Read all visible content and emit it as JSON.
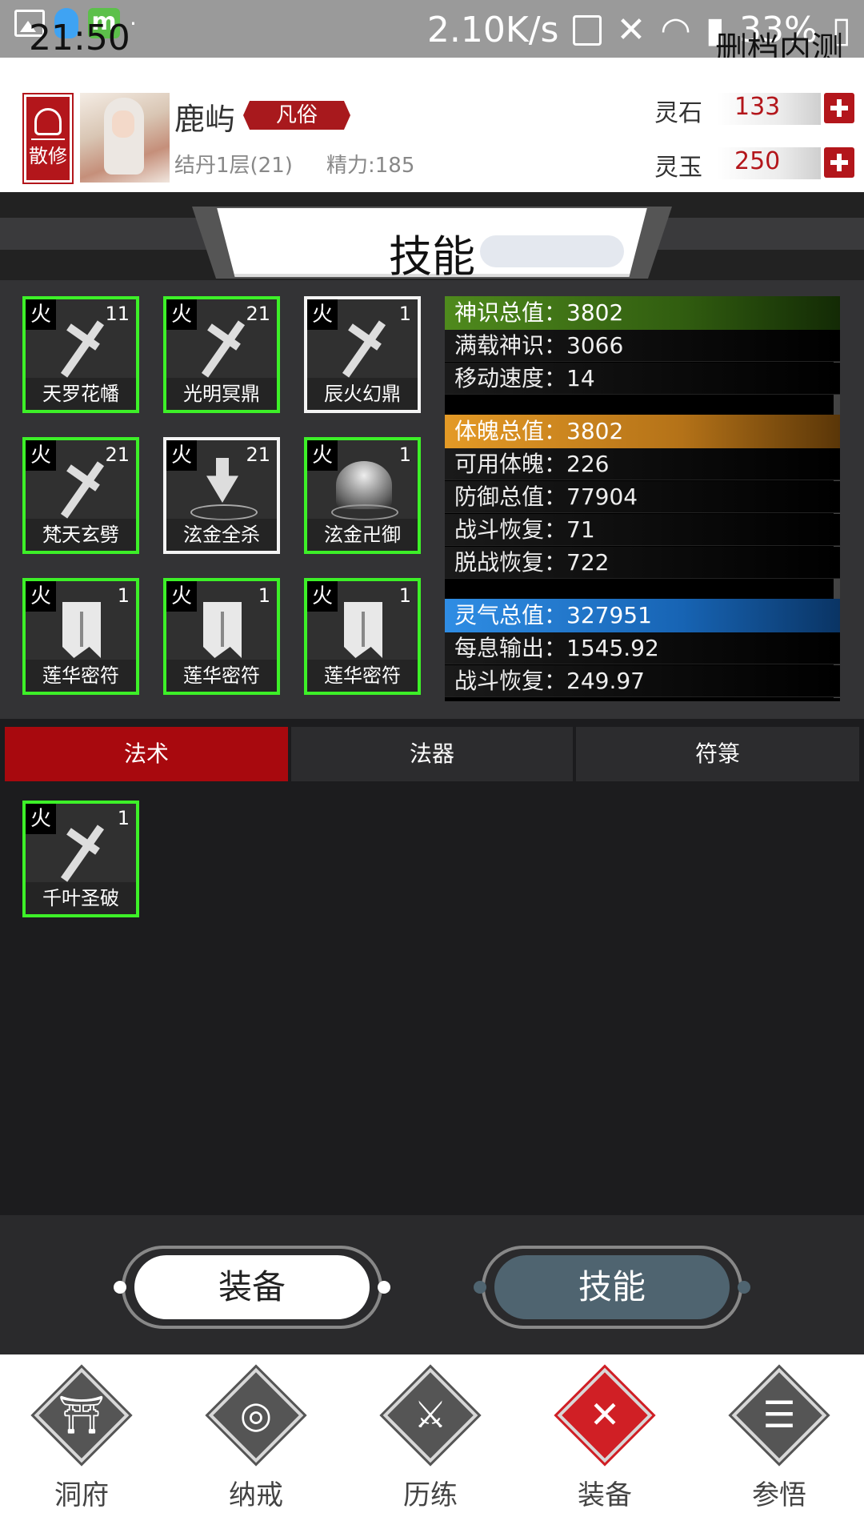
{
  "status_bar": {
    "clock": "21:50",
    "speed": "2.10K/s",
    "battery": "33%",
    "notice": "删档内测"
  },
  "player": {
    "sect": "散修",
    "name": "鹿屿",
    "realm": "凡俗",
    "level": "结丹1层(21)",
    "stamina": "精力:185"
  },
  "currencies": [
    {
      "label": "灵石",
      "value": "133",
      "add_icon": "plus-icon"
    },
    {
      "label": "灵玉",
      "value": "250",
      "add_icon": "plus-icon"
    }
  ],
  "panel": {
    "title": "技能"
  },
  "skills": [
    {
      "element": "火",
      "level": "11",
      "name": "天罗花幡",
      "icon": "sword-icon",
      "border": "#3df028"
    },
    {
      "element": "火",
      "level": "21",
      "name": "光明冥鼎",
      "icon": "sword-icon",
      "border": "#3df028"
    },
    {
      "element": "火",
      "level": "1",
      "name": "辰火幻鼎",
      "icon": "sword-icon",
      "border": "#f4f4f4"
    },
    {
      "element": "火",
      "level": "21",
      "name": "梵天玄劈",
      "icon": "sword-icon",
      "border": "#3df028"
    },
    {
      "element": "火",
      "level": "21",
      "name": "泫金全杀",
      "icon": "spike-icon",
      "border": "#f4f4f4"
    },
    {
      "element": "火",
      "level": "1",
      "name": "泫金卍御",
      "icon": "orb-icon",
      "border": "#3df028"
    },
    {
      "element": "火",
      "level": "1",
      "name": "莲华密符",
      "icon": "talisman-icon",
      "border": "#3df028"
    },
    {
      "element": "火",
      "level": "1",
      "name": "莲华密符",
      "icon": "talisman-icon",
      "border": "#3df028"
    },
    {
      "element": "火",
      "level": "1",
      "name": "莲华密符",
      "icon": "talisman-icon",
      "border": "#3df028"
    }
  ],
  "stats": {
    "groups": [
      {
        "header": "神识总值：3802",
        "color": "#4f8a1d",
        "rows": [
          "满载神识：3066",
          "移动速度：14"
        ]
      },
      {
        "header": "体魄总值：3802",
        "color": "#e49a26",
        "rows": [
          "可用体魄：226",
          "防御总值：77904",
          "战斗恢复：71",
          "脱战恢复：722"
        ]
      },
      {
        "header": "灵气总值：327951",
        "color": "#2f8de4",
        "rows": [
          "每息输出：1545.92",
          "战斗恢复：249.97"
        ]
      }
    ]
  },
  "tabs": [
    {
      "label": "法术",
      "active": true
    },
    {
      "label": "法器",
      "active": false
    },
    {
      "label": "符箓",
      "active": false
    }
  ],
  "owned_skills": [
    {
      "element": "火",
      "level": "1",
      "name": "千叶圣破",
      "icon": "sword-icon"
    }
  ],
  "toggle": {
    "equip": "装备",
    "skills": "技能"
  },
  "nav": [
    {
      "label": "洞府",
      "icon": "gate-icon",
      "active": false
    },
    {
      "label": "纳戒",
      "icon": "ring-icon",
      "active": false
    },
    {
      "label": "历练",
      "icon": "crossed-swords-icon",
      "active": false
    },
    {
      "label": "装备",
      "icon": "close-icon",
      "active": true
    },
    {
      "label": "参悟",
      "icon": "book-icon",
      "active": false
    }
  ],
  "colors": {
    "accent": "#a8090e",
    "equipped_border": "#3df028"
  }
}
